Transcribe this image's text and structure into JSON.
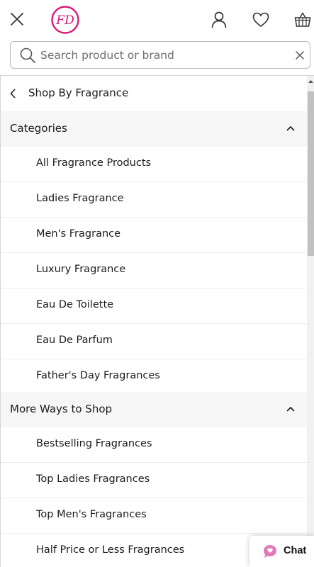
{
  "header": {
    "close_icon": "close-icon",
    "logo_text": "FD",
    "logo_color": "#d81b7a",
    "account_icon": "user-icon",
    "wishlist_icon": "heart-icon",
    "basket_icon": "basket-icon"
  },
  "search": {
    "placeholder": "Search product or brand",
    "value": "",
    "icon": "search-icon",
    "clear_icon": "clear-icon"
  },
  "menu": {
    "back_label": "Shop By Fragrance",
    "sections": [
      {
        "title": "Categories",
        "expanded": true,
        "items": [
          {
            "label": "All Fragrance Products"
          },
          {
            "label": "Ladies Fragrance"
          },
          {
            "label": "Men's Fragrance"
          },
          {
            "label": "Luxury Fragrance"
          },
          {
            "label": "Eau De Toilette"
          },
          {
            "label": "Eau De Parfum"
          },
          {
            "label": "Father's Day Fragrances"
          }
        ]
      },
      {
        "title": "More Ways to Shop",
        "expanded": true,
        "items": [
          {
            "label": "Bestselling Fragrances"
          },
          {
            "label": "Top Ladies Fragrances"
          },
          {
            "label": "Top Men's Fragrances"
          },
          {
            "label": "Half Price or Less Fragrances"
          }
        ]
      }
    ]
  },
  "chat": {
    "label": "Chat",
    "icon": "chat-bubble-icon",
    "icon_color": "#e07ab8"
  },
  "colors": {
    "section_background": "#f6f6f6",
    "divider": "#eeeeee",
    "text": "#1b1b1b"
  }
}
